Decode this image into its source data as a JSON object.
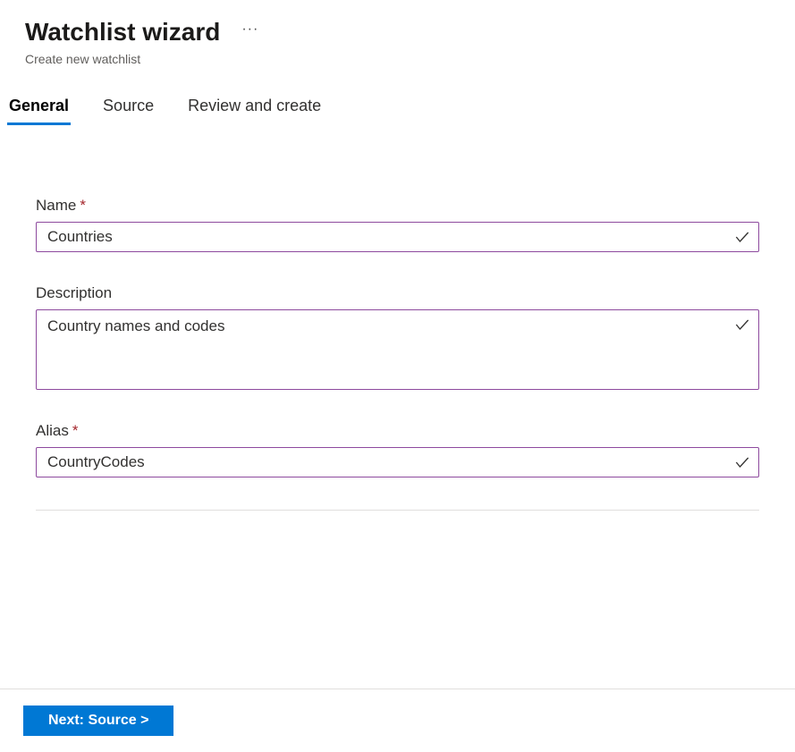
{
  "header": {
    "title": "Watchlist wizard",
    "subtitle": "Create new watchlist"
  },
  "tabs": {
    "general": "General",
    "source": "Source",
    "review": "Review and create"
  },
  "form": {
    "name": {
      "label": "Name",
      "value": "Countries"
    },
    "description": {
      "label": "Description",
      "value": "Country names and codes"
    },
    "alias": {
      "label": "Alias",
      "value": "CountryCodes"
    }
  },
  "footer": {
    "next_label": "Next: Source >"
  }
}
